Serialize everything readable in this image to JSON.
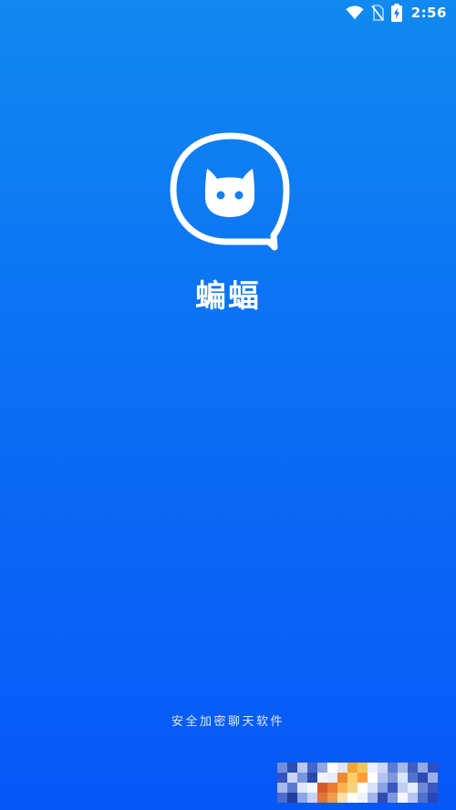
{
  "status_bar": {
    "time": "2:56",
    "icons": [
      "wifi-icon",
      "no-sim-icon",
      "battery-charging-icon"
    ]
  },
  "app": {
    "name": "蝙蝠",
    "logo": "cat-chat-bubble-logo",
    "slogan": "安全加密聊天软件"
  },
  "colors": {
    "background_top": "#1189f0",
    "background_bottom": "#0757f7",
    "foreground": "#ffffff"
  },
  "pixel_thumbnail": {
    "icon": "pixelated-image",
    "colors": [
      "#6f8fd8",
      "#2d4db0",
      "#b9c8ee",
      "#4366c8",
      "#8fa8e4",
      "#ffffff",
      "#dfe7fb",
      "#f0a43a",
      "#f7c65a",
      "#e9f0ff",
      "#cbd7f6",
      "#5a7bd0",
      "#a6b8ea",
      "#3f5fbf",
      "#93a9e6",
      "#2e4fc2",
      "#3553bd",
      "#c9d5f5",
      "#7a96dc",
      "#2b47aa",
      "#f2f5ff",
      "#e8ecfa",
      "#f08a2f",
      "#ffcc66",
      "#ff9e3d",
      "#ffffff",
      "#b3c4ef",
      "#7e98dd",
      "#dce4fa",
      "#5473cc",
      "#2d49b4",
      "#9bb0e7",
      "#a7b9ea",
      "#5d7ad0",
      "#e1e8fb",
      "#f5f7ff",
      "#d55a2a",
      "#ee7a34",
      "#ffb450",
      "#f7d27c",
      "#ffffff",
      "#d9e2f9",
      "#8aa2e2",
      "#3856bd",
      "#c0cff3",
      "#e7edfc",
      "#6c88d6",
      "#3a58c0",
      "#4a6bca",
      "#1f3e9e",
      "#8ea6e3",
      "#c6d3f4",
      "#e0743a",
      "#f19b4f",
      "#ffe1a8",
      "#ffffff",
      "#eef3ff",
      "#a1b5e9",
      "#2f4cb6",
      "#7d97dc",
      "#f4f7ff",
      "#b6c6f0",
      "#4f70cd",
      "#2747b7"
    ]
  }
}
